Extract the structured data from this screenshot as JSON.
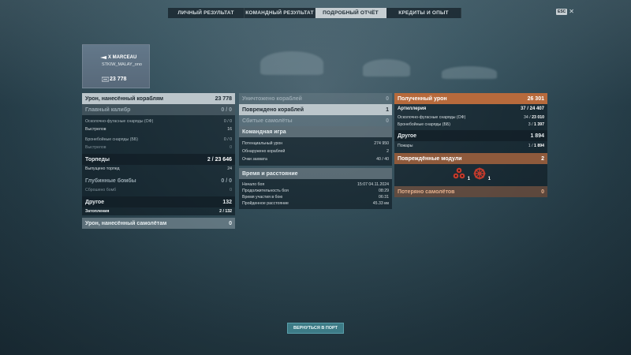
{
  "tabs": [
    {
      "label": "ЛИЧНЫЙ РЕЗУЛЬТАТ",
      "active": false
    },
    {
      "label": "КОМАНДНЫЙ РЕЗУЛЬТАТ",
      "active": false
    },
    {
      "label": "ПОДРОБНЫЙ ОТЧЁТ",
      "active": true
    },
    {
      "label": "КРЕДИТЫ И ОПЫТ",
      "active": false
    }
  ],
  "esc_label": "ESC",
  "ship": {
    "name": "X MARCEAU",
    "player": "STKIW_MALAY_ono",
    "xp": "23 778"
  },
  "left": {
    "damage_header": {
      "label": "Урон, нанесённый кораблям",
      "value": "23 778"
    },
    "main_battery": {
      "label": "Главный калибр",
      "value": "0 / 0"
    },
    "he_shells": {
      "label": "Осколочно-фугасные снаряды (ОФ)",
      "value": "0 / 0"
    },
    "he_shots": {
      "label": "Выстрелов",
      "value": "16"
    },
    "ap_shells": {
      "label": "Бронебойные снаряды (ББ)",
      "value": "0 / 0"
    },
    "ap_shots": {
      "label": "Выстрелов",
      "value": "0"
    },
    "torpedoes": {
      "label": "Торпеды",
      "value_a": "2",
      "value_b": "23 646"
    },
    "torpedoes_launched": {
      "label": "Выпущено торпед",
      "value": "24"
    },
    "depth_charges": {
      "label": "Глубинные бомбы",
      "value": "0 / 0"
    },
    "depth_dropped": {
      "label": "Сброшено бомб",
      "value": "0"
    },
    "other": {
      "label": "Другое",
      "value": "132"
    },
    "flooding": {
      "label": "Затопления",
      "value_a": "2",
      "value_b": "132"
    },
    "aircraft_damage": {
      "label": "Урон, нанесённый самолётам",
      "value": "0"
    }
  },
  "middle": {
    "ships_destroyed": {
      "label": "Уничтожено кораблей",
      "value": "0"
    },
    "ships_damaged": {
      "label": "Повреждено кораблей",
      "value": "1"
    },
    "planes_shot": {
      "label": "Сбитые самолёты",
      "value": "0"
    },
    "team_header": "Командная игра",
    "potential_damage": {
      "label": "Потенциальный урон",
      "value": "274 950"
    },
    "ships_spotted": {
      "label": "Обнаружено кораблей",
      "value": "2"
    },
    "capture_points": {
      "label": "Очки захвата",
      "value": "40 / 40"
    },
    "time_header": "Время и расстояние",
    "battle_start": {
      "label": "Начало боя",
      "value": "15:07  04.11.2024"
    },
    "battle_duration": {
      "label": "Продолжительность боя",
      "value": "08:29"
    },
    "time_in_battle": {
      "label": "Время участия в бою",
      "value": "06:31"
    },
    "distance": {
      "label": "Пройденное расстояние",
      "value": "45.33 км"
    }
  },
  "right": {
    "received_header": {
      "label": "Полученный урон",
      "value": "26 301"
    },
    "artillery": {
      "label": "Артиллерия",
      "value_a": "37",
      "value_b": "24 407"
    },
    "he_received": {
      "label": "Осколочно-фугасные снаряды (ОФ)",
      "value_a": "34",
      "value_b": "23 010"
    },
    "ap_received": {
      "label": "Бронебойные снаряды (ББ)",
      "value_a": "3",
      "value_b": "1 397"
    },
    "other": {
      "label": "Другое",
      "value": "1 894"
    },
    "fires": {
      "label": "Пожары",
      "value_a": "1",
      "value_b": "1 894"
    },
    "modules_header": {
      "label": "Повреждённые модули",
      "value": "2"
    },
    "module_counts": [
      "1",
      "1"
    ],
    "planes_lost": {
      "label": "Потеряно самолётов",
      "value": "0"
    }
  },
  "back_button": "ВЕРНУТЬСЯ В ПОРТ"
}
